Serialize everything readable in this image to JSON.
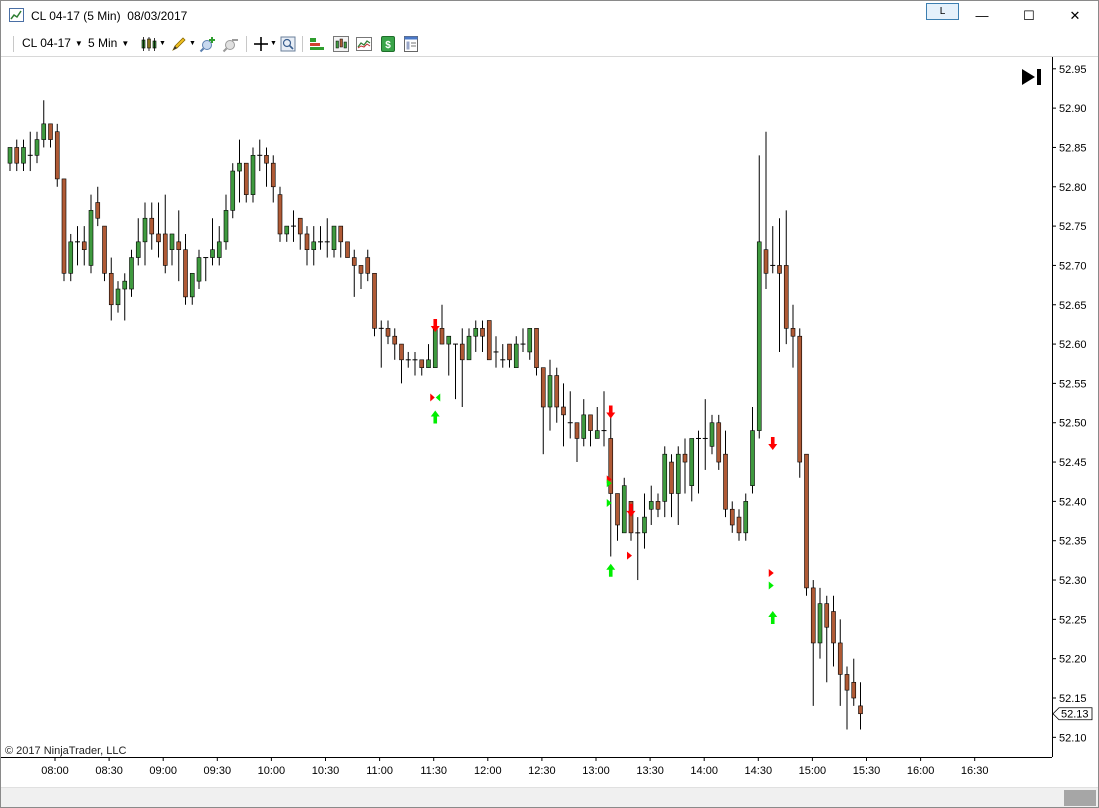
{
  "window": {
    "title": "CL 04-17 (5 Min)",
    "date": "08/03/2017",
    "link_label": "L",
    "minimize": "—",
    "maximize": "☐",
    "close": "✕"
  },
  "toolbar": {
    "instrument": "CL 04-17",
    "interval": "5 Min",
    "icons": [
      "bar-type-icon",
      "drawing-tool-icon",
      "zoom-in-icon",
      "zoom-out-icon",
      "crosshair-icon",
      "data-box-icon",
      "strategies-icon",
      "indicators-icon",
      "chart-style-icon",
      "order-entry-icon",
      "properties-icon"
    ]
  },
  "copyright": "© 2017 NinjaTrader, LLC",
  "colors": {
    "up_candle": "#3f9a3f",
    "down_candle": "#b05a35",
    "wick": "#000000",
    "buy_signal": "#00ee00",
    "sell_signal": "#ff0000"
  },
  "chart_data": {
    "type": "candlestick",
    "title": "",
    "xlabel": "",
    "ylabel": "",
    "ylim": [
      52.075,
      52.965
    ],
    "y_ticks": [
      "52.95",
      "52.90",
      "52.85",
      "52.80",
      "52.75",
      "52.70",
      "52.65",
      "52.60",
      "52.55",
      "52.50",
      "52.45",
      "52.40",
      "52.35",
      "52.30",
      "52.25",
      "52.20",
      "52.15",
      "52.10"
    ],
    "x_ticks": [
      "08:00",
      "08:30",
      "09:00",
      "09:30",
      "10:00",
      "10:30",
      "11:00",
      "11:30",
      "12:00",
      "12:30",
      "13:00",
      "13:30",
      "14:00",
      "14:30",
      "15:00",
      "15:30",
      "16:00",
      "16:30"
    ],
    "last_price": "52.13",
    "candles": [
      {
        "o": 52.83,
        "h": 52.85,
        "l": 52.82,
        "c": 52.85
      },
      {
        "o": 52.85,
        "h": 52.86,
        "l": 52.82,
        "c": 52.83
      },
      {
        "o": 52.83,
        "h": 52.86,
        "l": 52.82,
        "c": 52.85
      },
      {
        "o": 52.84,
        "h": 52.87,
        "l": 52.82,
        "c": 52.84
      },
      {
        "o": 52.84,
        "h": 52.87,
        "l": 52.83,
        "c": 52.86
      },
      {
        "o": 52.86,
        "h": 52.91,
        "l": 52.85,
        "c": 52.88
      },
      {
        "o": 52.88,
        "h": 52.88,
        "l": 52.85,
        "c": 52.86
      },
      {
        "o": 52.87,
        "h": 52.88,
        "l": 52.8,
        "c": 52.81
      },
      {
        "o": 52.81,
        "h": 52.81,
        "l": 52.68,
        "c": 52.69
      },
      {
        "o": 52.69,
        "h": 52.74,
        "l": 52.68,
        "c": 52.73
      },
      {
        "o": 52.73,
        "h": 52.75,
        "l": 52.7,
        "c": 52.73
      },
      {
        "o": 52.73,
        "h": 52.75,
        "l": 52.7,
        "c": 52.72
      },
      {
        "o": 52.7,
        "h": 52.79,
        "l": 52.69,
        "c": 52.77
      },
      {
        "o": 52.78,
        "h": 52.8,
        "l": 52.75,
        "c": 52.76
      },
      {
        "o": 52.75,
        "h": 52.75,
        "l": 52.68,
        "c": 52.69
      },
      {
        "o": 52.69,
        "h": 52.71,
        "l": 52.63,
        "c": 52.65
      },
      {
        "o": 52.65,
        "h": 52.68,
        "l": 52.64,
        "c": 52.67
      },
      {
        "o": 52.67,
        "h": 52.69,
        "l": 52.63,
        "c": 52.68
      },
      {
        "o": 52.67,
        "h": 52.72,
        "l": 52.66,
        "c": 52.71
      },
      {
        "o": 52.71,
        "h": 52.76,
        "l": 52.7,
        "c": 52.73
      },
      {
        "o": 52.73,
        "h": 52.78,
        "l": 52.7,
        "c": 52.76
      },
      {
        "o": 52.76,
        "h": 52.78,
        "l": 52.72,
        "c": 52.74
      },
      {
        "o": 52.74,
        "h": 52.78,
        "l": 52.71,
        "c": 52.73
      },
      {
        "o": 52.74,
        "h": 52.79,
        "l": 52.69,
        "c": 52.7
      },
      {
        "o": 52.72,
        "h": 52.74,
        "l": 52.7,
        "c": 52.74
      },
      {
        "o": 52.73,
        "h": 52.77,
        "l": 52.68,
        "c": 52.72
      },
      {
        "o": 52.72,
        "h": 52.74,
        "l": 52.65,
        "c": 52.66
      },
      {
        "o": 52.66,
        "h": 52.69,
        "l": 52.65,
        "c": 52.69
      },
      {
        "o": 52.68,
        "h": 52.72,
        "l": 52.67,
        "c": 52.71
      },
      {
        "o": 52.71,
        "h": 52.71,
        "l": 52.68,
        "c": 52.71
      },
      {
        "o": 52.71,
        "h": 52.76,
        "l": 52.7,
        "c": 52.72
      },
      {
        "o": 52.71,
        "h": 52.75,
        "l": 52.7,
        "c": 52.73
      },
      {
        "o": 52.73,
        "h": 52.79,
        "l": 52.72,
        "c": 52.77
      },
      {
        "o": 52.77,
        "h": 52.83,
        "l": 52.76,
        "c": 52.82
      },
      {
        "o": 52.82,
        "h": 52.86,
        "l": 52.78,
        "c": 52.83
      },
      {
        "o": 52.83,
        "h": 52.83,
        "l": 52.78,
        "c": 52.79
      },
      {
        "o": 52.79,
        "h": 52.85,
        "l": 52.78,
        "c": 52.84
      },
      {
        "o": 52.84,
        "h": 52.86,
        "l": 52.82,
        "c": 52.84
      },
      {
        "o": 52.84,
        "h": 52.85,
        "l": 52.8,
        "c": 52.83
      },
      {
        "o": 52.83,
        "h": 52.84,
        "l": 52.78,
        "c": 52.8
      },
      {
        "o": 52.79,
        "h": 52.8,
        "l": 52.73,
        "c": 52.74
      },
      {
        "o": 52.74,
        "h": 52.75,
        "l": 52.73,
        "c": 52.75
      },
      {
        "o": 52.75,
        "h": 52.77,
        "l": 52.73,
        "c": 52.75
      },
      {
        "o": 52.76,
        "h": 52.76,
        "l": 52.72,
        "c": 52.74
      },
      {
        "o": 52.74,
        "h": 52.75,
        "l": 52.7,
        "c": 52.72
      },
      {
        "o": 52.72,
        "h": 52.75,
        "l": 52.7,
        "c": 52.73
      },
      {
        "o": 52.73,
        "h": 52.75,
        "l": 52.72,
        "c": 52.73
      },
      {
        "o": 52.73,
        "h": 52.76,
        "l": 52.71,
        "c": 52.73
      },
      {
        "o": 52.72,
        "h": 52.75,
        "l": 52.71,
        "c": 52.75
      },
      {
        "o": 52.75,
        "h": 52.75,
        "l": 52.71,
        "c": 52.73
      },
      {
        "o": 52.73,
        "h": 52.73,
        "l": 52.71,
        "c": 52.71
      },
      {
        "o": 52.71,
        "h": 52.72,
        "l": 52.66,
        "c": 52.7
      },
      {
        "o": 52.7,
        "h": 52.7,
        "l": 52.67,
        "c": 52.69
      },
      {
        "o": 52.71,
        "h": 52.72,
        "l": 52.68,
        "c": 52.69
      },
      {
        "o": 52.69,
        "h": 52.69,
        "l": 52.61,
        "c": 52.62
      },
      {
        "o": 52.62,
        "h": 52.63,
        "l": 52.57,
        "c": 52.62
      },
      {
        "o": 52.62,
        "h": 52.63,
        "l": 52.6,
        "c": 52.61
      },
      {
        "o": 52.61,
        "h": 52.62,
        "l": 52.58,
        "c": 52.6
      },
      {
        "o": 52.6,
        "h": 52.6,
        "l": 52.55,
        "c": 52.58
      },
      {
        "o": 52.58,
        "h": 52.59,
        "l": 52.57,
        "c": 52.58
      },
      {
        "o": 52.58,
        "h": 52.59,
        "l": 52.56,
        "c": 52.58
      },
      {
        "o": 52.58,
        "h": 52.58,
        "l": 52.56,
        "c": 52.57
      },
      {
        "o": 52.57,
        "h": 52.6,
        "l": 52.57,
        "c": 52.58
      },
      {
        "o": 52.57,
        "h": 52.63,
        "l": 52.57,
        "c": 52.62
      },
      {
        "o": 52.62,
        "h": 52.65,
        "l": 52.6,
        "c": 52.6
      },
      {
        "o": 52.6,
        "h": 52.61,
        "l": 52.56,
        "c": 52.61
      },
      {
        "o": 52.6,
        "h": 52.6,
        "l": 52.53,
        "c": 52.6
      },
      {
        "o": 52.6,
        "h": 52.62,
        "l": 52.52,
        "c": 52.58
      },
      {
        "o": 52.58,
        "h": 52.62,
        "l": 52.58,
        "c": 52.61
      },
      {
        "o": 52.61,
        "h": 52.63,
        "l": 52.59,
        "c": 52.62
      },
      {
        "o": 52.62,
        "h": 52.63,
        "l": 52.59,
        "c": 52.61
      },
      {
        "o": 52.63,
        "h": 52.63,
        "l": 52.58,
        "c": 52.58
      },
      {
        "o": 52.59,
        "h": 52.61,
        "l": 52.57,
        "c": 52.59
      },
      {
        "o": 52.58,
        "h": 52.6,
        "l": 52.57,
        "c": 52.58
      },
      {
        "o": 52.6,
        "h": 52.6,
        "l": 52.57,
        "c": 52.58
      },
      {
        "o": 52.57,
        "h": 52.61,
        "l": 52.57,
        "c": 52.6
      },
      {
        "o": 52.6,
        "h": 52.62,
        "l": 52.59,
        "c": 52.6
      },
      {
        "o": 52.59,
        "h": 52.62,
        "l": 52.58,
        "c": 52.62
      },
      {
        "o": 52.62,
        "h": 52.62,
        "l": 52.56,
        "c": 52.57
      },
      {
        "o": 52.57,
        "h": 52.57,
        "l": 52.46,
        "c": 52.52
      },
      {
        "o": 52.52,
        "h": 52.58,
        "l": 52.49,
        "c": 52.56
      },
      {
        "o": 52.56,
        "h": 52.57,
        "l": 52.5,
        "c": 52.52
      },
      {
        "o": 52.52,
        "h": 52.55,
        "l": 52.47,
        "c": 52.51
      },
      {
        "o": 52.5,
        "h": 52.54,
        "l": 52.48,
        "c": 52.5
      },
      {
        "o": 52.5,
        "h": 52.5,
        "l": 52.45,
        "c": 52.48
      },
      {
        "o": 52.48,
        "h": 52.53,
        "l": 52.47,
        "c": 52.51
      },
      {
        "o": 52.51,
        "h": 52.51,
        "l": 52.47,
        "c": 52.49
      },
      {
        "o": 52.48,
        "h": 52.52,
        "l": 52.48,
        "c": 52.49
      },
      {
        "o": 52.49,
        "h": 52.54,
        "l": 52.47,
        "c": 52.49
      },
      {
        "o": 52.48,
        "h": 52.51,
        "l": 52.33,
        "c": 52.41
      },
      {
        "o": 52.41,
        "h": 52.41,
        "l": 52.35,
        "c": 52.37
      },
      {
        "o": 52.36,
        "h": 52.43,
        "l": 52.36,
        "c": 52.42
      },
      {
        "o": 52.4,
        "h": 52.4,
        "l": 52.35,
        "c": 52.36
      },
      {
        "o": 52.36,
        "h": 52.38,
        "l": 52.3,
        "c": 52.36
      },
      {
        "o": 52.36,
        "h": 52.41,
        "l": 52.34,
        "c": 52.38
      },
      {
        "o": 52.39,
        "h": 52.42,
        "l": 52.37,
        "c": 52.4
      },
      {
        "o": 52.4,
        "h": 52.41,
        "l": 52.38,
        "c": 52.39
      },
      {
        "o": 52.4,
        "h": 52.47,
        "l": 52.38,
        "c": 52.46
      },
      {
        "o": 52.45,
        "h": 52.46,
        "l": 52.38,
        "c": 52.41
      },
      {
        "o": 52.41,
        "h": 52.47,
        "l": 52.37,
        "c": 52.46
      },
      {
        "o": 52.46,
        "h": 52.48,
        "l": 52.41,
        "c": 52.45
      },
      {
        "o": 52.42,
        "h": 52.48,
        "l": 52.4,
        "c": 52.48
      },
      {
        "o": 52.48,
        "h": 52.49,
        "l": 52.41,
        "c": 52.48
      },
      {
        "o": 52.48,
        "h": 52.53,
        "l": 52.44,
        "c": 52.48
      },
      {
        "o": 52.47,
        "h": 52.51,
        "l": 52.46,
        "c": 52.5
      },
      {
        "o": 52.5,
        "h": 52.51,
        "l": 52.44,
        "c": 52.45
      },
      {
        "o": 52.46,
        "h": 52.49,
        "l": 52.38,
        "c": 52.39
      },
      {
        "o": 52.39,
        "h": 52.4,
        "l": 52.36,
        "c": 52.37
      },
      {
        "o": 52.38,
        "h": 52.39,
        "l": 52.35,
        "c": 52.36
      },
      {
        "o": 52.36,
        "h": 52.41,
        "l": 52.35,
        "c": 52.4
      },
      {
        "o": 52.42,
        "h": 52.52,
        "l": 52.41,
        "c": 52.49
      },
      {
        "o": 52.49,
        "h": 52.84,
        "l": 52.48,
        "c": 52.73
      },
      {
        "o": 52.72,
        "h": 52.87,
        "l": 52.67,
        "c": 52.69
      },
      {
        "o": 52.7,
        "h": 52.75,
        "l": 52.69,
        "c": 52.7
      },
      {
        "o": 52.7,
        "h": 52.76,
        "l": 52.59,
        "c": 52.69
      },
      {
        "o": 52.7,
        "h": 52.77,
        "l": 52.6,
        "c": 52.62
      },
      {
        "o": 52.62,
        "h": 52.65,
        "l": 52.57,
        "c": 52.61
      },
      {
        "o": 52.61,
        "h": 52.62,
        "l": 52.43,
        "c": 52.45
      },
      {
        "o": 52.46,
        "h": 52.46,
        "l": 52.28,
        "c": 52.29
      },
      {
        "o": 52.29,
        "h": 52.3,
        "l": 52.14,
        "c": 52.22
      },
      {
        "o": 52.22,
        "h": 52.29,
        "l": 52.2,
        "c": 52.27
      },
      {
        "o": 52.27,
        "h": 52.28,
        "l": 52.17,
        "c": 52.24
      },
      {
        "o": 52.26,
        "h": 52.28,
        "l": 52.19,
        "c": 52.22
      },
      {
        "o": 52.22,
        "h": 52.25,
        "l": 52.14,
        "c": 52.18
      },
      {
        "o": 52.18,
        "h": 52.19,
        "l": 52.11,
        "c": 52.16
      },
      {
        "o": 52.17,
        "h": 52.2,
        "l": 52.14,
        "c": 52.15
      },
      {
        "o": 52.14,
        "h": 52.17,
        "l": 52.11,
        "c": 52.13
      }
    ],
    "signals": [
      {
        "bar": 63,
        "kind": "arrow-down",
        "price": 52.623
      },
      {
        "bar": 63,
        "kind": "diamond",
        "price": 52.532
      },
      {
        "bar": 63,
        "kind": "arrow-up",
        "price": 52.508
      },
      {
        "bar": 89,
        "kind": "arrow-down",
        "price": 52.513
      },
      {
        "bar": 89,
        "kind": "tri-right-red",
        "price": 52.428
      },
      {
        "bar": 89,
        "kind": "tri-right-green",
        "price": 52.423
      },
      {
        "bar": 89,
        "kind": "tri-right-green",
        "price": 52.398
      },
      {
        "bar": 89,
        "kind": "arrow-up",
        "price": 52.313
      },
      {
        "bar": 92,
        "kind": "arrow-down",
        "price": 52.388
      },
      {
        "bar": 92,
        "kind": "tri-right-red",
        "price": 52.331
      },
      {
        "bar": 113,
        "kind": "arrow-down",
        "price": 52.473
      },
      {
        "bar": 113,
        "kind": "tri-right-red",
        "price": 52.309
      },
      {
        "bar": 113,
        "kind": "tri-right-green",
        "price": 52.293
      },
      {
        "bar": 113,
        "kind": "arrow-up",
        "price": 52.253
      }
    ]
  }
}
